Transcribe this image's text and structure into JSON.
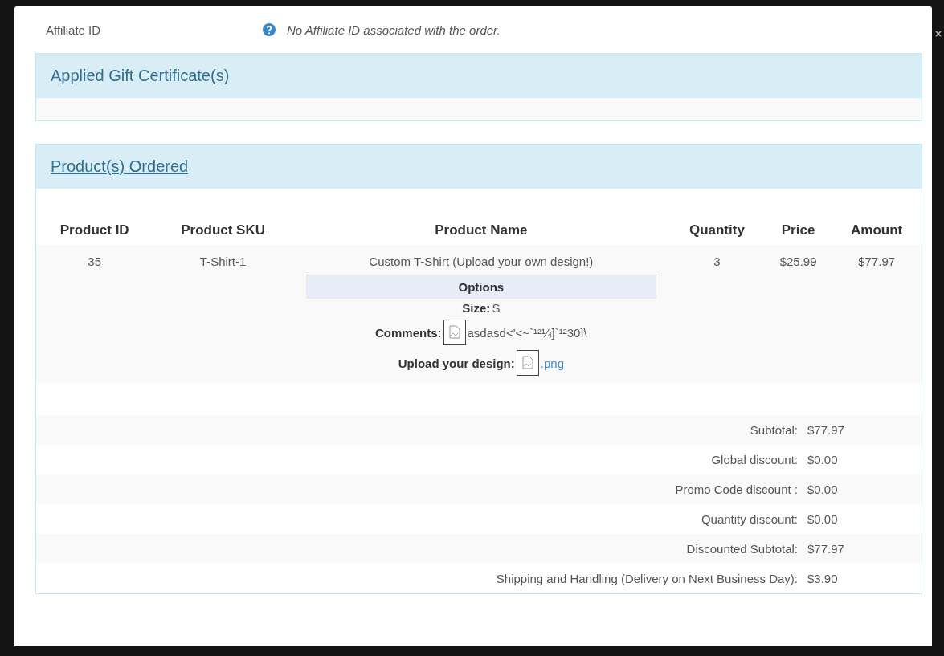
{
  "affiliate": {
    "label": "Affiliate ID",
    "value": "No Affiliate ID associated with the order."
  },
  "gift_panel": {
    "title": "Applied Gift Certificate(s)"
  },
  "products_panel": {
    "title": "Product(s) Ordered",
    "columns": [
      "Product ID",
      "Product SKU",
      "Product Name",
      "Quantity",
      "Price",
      "Amount"
    ],
    "rows": [
      {
        "product_id": "35",
        "sku": "T-Shirt-1",
        "name": "Custom T-Shirt (Upload your own design!)",
        "options_title": "Options",
        "quantity": "3",
        "price": "$25.99",
        "amount": "$77.97",
        "options": [
          {
            "kind": "text",
            "label": "Size:",
            "value": "S"
          },
          {
            "kind": "image",
            "label": "Comments:",
            "value": "asdasd<'<~`¹²¼]`¹²30ì\\"
          },
          {
            "kind": "image-link",
            "label": "Upload your design:",
            "value": ".png"
          }
        ]
      }
    ],
    "summary": [
      {
        "label": "Subtotal:",
        "value": "$77.97"
      },
      {
        "label": "Global discount:",
        "value": "$0.00"
      },
      {
        "label": "Promo Code discount :",
        "value": "$0.00"
      },
      {
        "label": "Quantity discount:",
        "value": "$0.00"
      },
      {
        "label": "Discounted Subtotal:",
        "value": "$77.97"
      },
      {
        "label": "Shipping and Handling (Delivery on Next Business Day):",
        "value": "$3.90"
      }
    ]
  }
}
